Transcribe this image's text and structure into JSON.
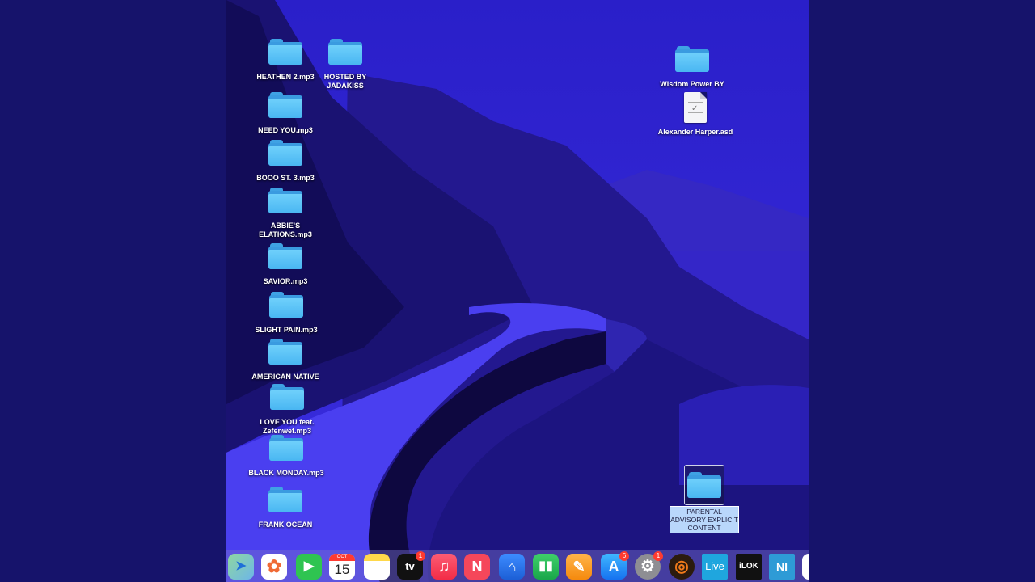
{
  "desktop": {
    "left_icons": [
      {
        "label": "HEATHEN 2.mp3"
      },
      {
        "label": "HOSTED BY JADAKISS"
      },
      {
        "label": "NEED YOU.mp3"
      },
      {
        "label": "BOOO ST. 3.mp3"
      },
      {
        "label": "ABBIE'S ELATIONS.mp3"
      },
      {
        "label": "SAVIOR.mp3"
      },
      {
        "label": "SLIGHT PAIN.mp3"
      },
      {
        "label": "AMERICAN NATIVE"
      },
      {
        "label": "LOVE YOU feat. Zefenwef.mp3"
      },
      {
        "label": "BLACK MONDAY.mp3"
      },
      {
        "label": "FRANK OCEAN"
      }
    ],
    "right_icons": [
      {
        "label": "Wisdom Power BY"
      },
      {
        "label": "Alexander Harper.asd"
      }
    ],
    "selected_icon": {
      "label": "PARENTAL ADVISORY EXPLICIT CONTENT"
    }
  },
  "dock": {
    "calendar_month": "OCT",
    "calendar_day": "15",
    "tv_label": "tv",
    "tv_badge": "1",
    "appstore_badge": "6",
    "settings_badge": "1",
    "live_label": "Live",
    "ilok_label": "iLOK",
    "ni_label": "NI"
  }
}
